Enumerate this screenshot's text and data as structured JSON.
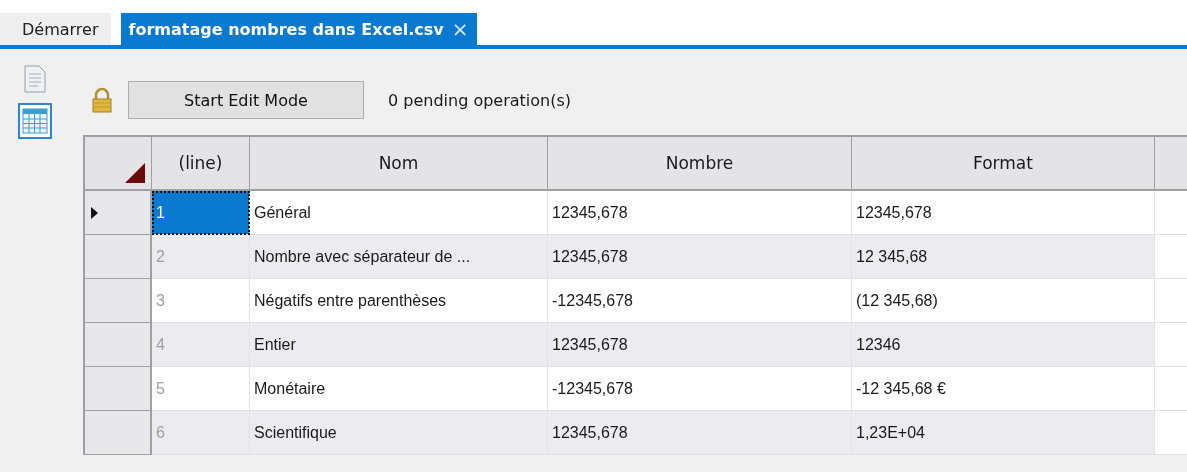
{
  "tabs": [
    {
      "label": "Démarrer",
      "selected": false
    },
    {
      "label": "formatage nombres dans Excel.csv",
      "selected": true,
      "close": "×"
    }
  ],
  "views": [
    {
      "kind": "document",
      "selected": false
    },
    {
      "kind": "table",
      "selected": true
    }
  ],
  "toolbar": {
    "locked": true,
    "button": "Start Edit Mode",
    "status": "0 pending operation(s)"
  },
  "table": {
    "columns": [
      "(line)",
      "Nom",
      "Nombre",
      "Format"
    ],
    "rows": [
      {
        "selected": true,
        "line": "1",
        "nom": "Général",
        "nombre": "12345,678",
        "format": "12345,678"
      },
      {
        "selected": false,
        "line": "2",
        "nom": "Nombre avec séparateur de ...",
        "nombre": "12345,678",
        "format": "12 345,68"
      },
      {
        "selected": false,
        "line": "3",
        "nom": "Négatifs entre parenthèses",
        "nombre": "-12345,678",
        "format": "(12 345,68)"
      },
      {
        "selected": false,
        "line": "4",
        "nom": "Entier",
        "nombre": "12345,678",
        "format": "12346"
      },
      {
        "selected": false,
        "line": "5",
        "nom": "Monétaire",
        "nombre": "-12345,678",
        "format": "-12 345,68 €"
      },
      {
        "selected": false,
        "line": "6",
        "nom": "Scientifique",
        "nombre": "12345,678",
        "format": "1,23E+04"
      }
    ]
  }
}
